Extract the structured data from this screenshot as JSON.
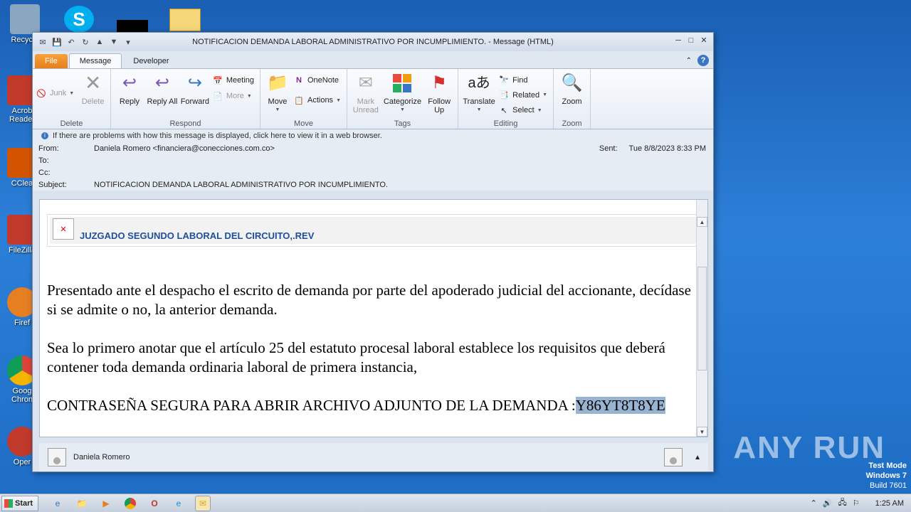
{
  "desktop": {
    "icons": [
      {
        "label": "Recycle",
        "color": "#8aa7c2"
      },
      {
        "label": "Acrob Reader",
        "color": "#c0392b"
      },
      {
        "label": "CClea",
        "color": "#d35400"
      },
      {
        "label": "FileZilla",
        "color": "#c0392b"
      },
      {
        "label": "Firef",
        "color": "#e67e22"
      },
      {
        "label": "Goog Chron",
        "color": "#2e8b57"
      },
      {
        "label": "Oper",
        "color": "#c0392b"
      }
    ]
  },
  "window": {
    "title": "NOTIFICACION DEMANDA LABORAL ADMINISTRATIVO POR INCUMPLIMIENTO. - Message (HTML)",
    "controls": {
      "minimize": "─",
      "restore": "□",
      "close": "✕"
    }
  },
  "tabs": {
    "file": "File",
    "message": "Message",
    "developer": "Developer"
  },
  "ribbon": {
    "delete_group": {
      "label": "Delete",
      "junk": "Junk",
      "delete": "Delete"
    },
    "respond_group": {
      "label": "Respond",
      "reply": "Reply",
      "reply_all": "Reply All",
      "forward": "Forward",
      "meeting": "Meeting",
      "more": "More"
    },
    "move_group": {
      "label": "Move",
      "move": "Move",
      "onenote": "OneNote",
      "actions": "Actions"
    },
    "tags_group": {
      "label": "Tags",
      "mark_unread": "Mark Unread",
      "categorize": "Categorize",
      "follow_up": "Follow Up"
    },
    "editing_group": {
      "label": "Editing",
      "translate": "Translate",
      "find": "Find",
      "related": "Related",
      "select": "Select"
    },
    "zoom_group": {
      "label": "Zoom",
      "zoom": "Zoom"
    }
  },
  "infobar": {
    "text": "If there are problems with how this message is displayed, click here to view it in a web browser."
  },
  "headers": {
    "from_label": "From:",
    "from_value": "Daniela Romero <financiera@conecciones.com.co>",
    "to_label": "To:",
    "cc_label": "Cc:",
    "subject_label": "Subject:",
    "subject_value": "NOTIFICACION DEMANDA LABORAL ADMINISTRATIVO POR INCUMPLIMIENTO.",
    "sent_label": "Sent:",
    "sent_value": "Tue 8/8/2023 8:33 PM"
  },
  "body": {
    "banner": "JUZGADO SEGUNDO LABORAL DEL CIRCUITO,.REV",
    "paragraph1": "Presentado ante el despacho el escrito de demanda por parte del apoderado judicial del accionante, decídase si se admite o no, la anterior demanda.",
    "paragraph2": "Sea lo primero anotar que el artículo 25 del estatuto procesal laboral establece los requisitos que deberá contener toda demanda ordinaria laboral de primera instancia,",
    "paragraph3_prefix": "CONTRASEÑA SEGURA PARA ABRIR ARCHIVO ADJUNTO DE LA DEMANDA :",
    "password": "Y86YT8T8YE"
  },
  "people_pane": {
    "name": "Daniela Romero"
  },
  "taskbar": {
    "start_label": "Start",
    "clock": "1:25 AM"
  },
  "watermark": "ANY RUN",
  "test_mode": {
    "line1": "Test Mode",
    "line2": "Windows 7",
    "line3": "Build 7601"
  }
}
